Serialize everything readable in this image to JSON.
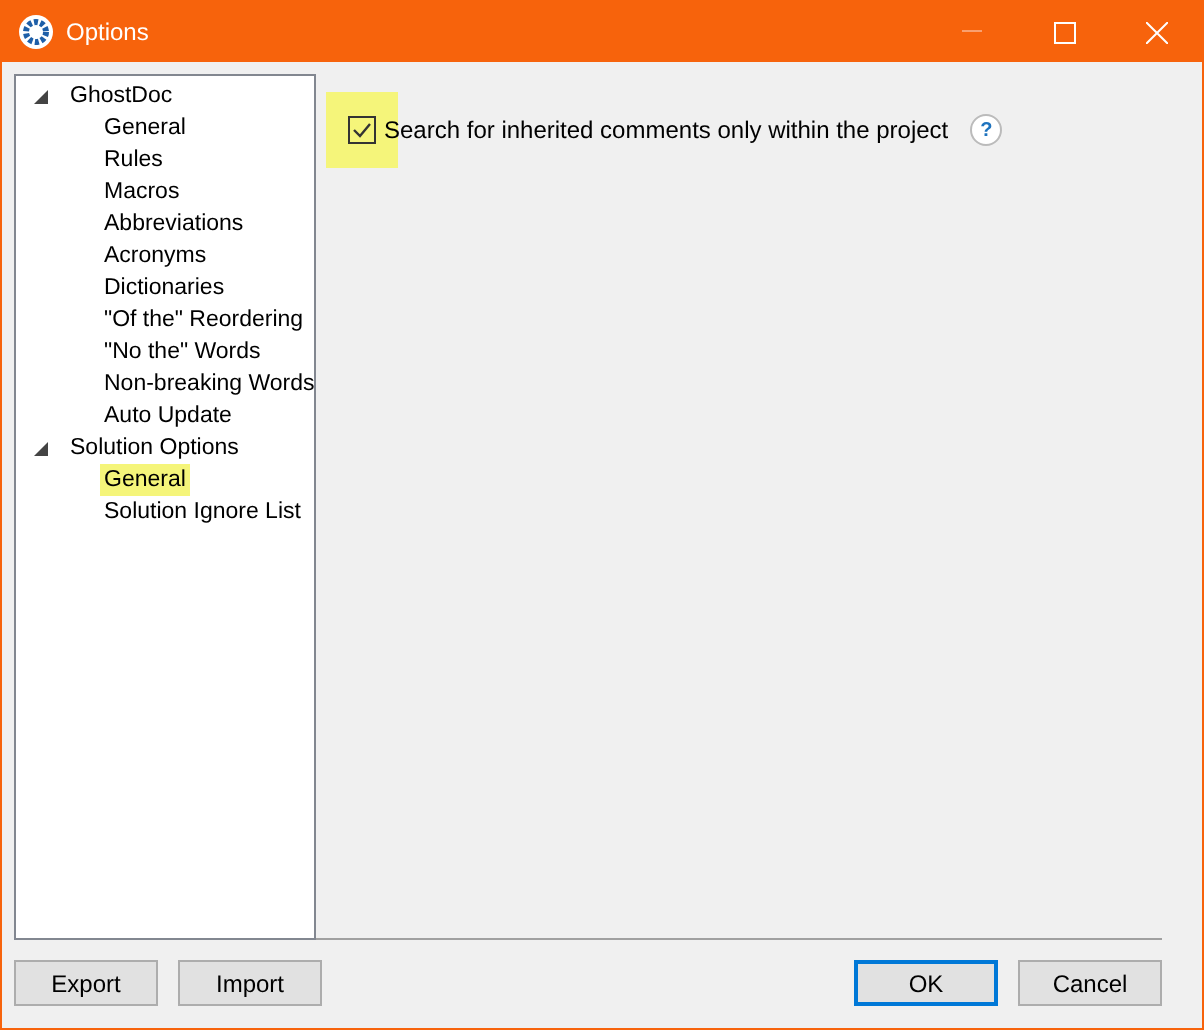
{
  "window": {
    "title": "Options",
    "minimize_disabled": true
  },
  "tree": [
    {
      "label": "GhostDoc",
      "expanded": true,
      "selected": false,
      "children": [
        {
          "label": "General",
          "selected": false
        },
        {
          "label": "Rules",
          "selected": false
        },
        {
          "label": "Macros",
          "selected": false
        },
        {
          "label": "Abbreviations",
          "selected": false
        },
        {
          "label": "Acronyms",
          "selected": false
        },
        {
          "label": "Dictionaries",
          "selected": false
        },
        {
          "label": "\"Of the\" Reordering",
          "selected": false
        },
        {
          "label": "\"No the\" Words",
          "selected": false
        },
        {
          "label": "Non-breaking Words",
          "selected": false
        },
        {
          "label": "Auto Update",
          "selected": false
        }
      ]
    },
    {
      "label": "Solution Options",
      "expanded": true,
      "selected": false,
      "children": [
        {
          "label": "General",
          "selected": true
        },
        {
          "label": "Solution Ignore List",
          "selected": false
        }
      ]
    }
  ],
  "option": {
    "label": "Search for inherited comments only within the project",
    "checked": true,
    "highlighted": true,
    "help": "?"
  },
  "left_buttons": [
    {
      "label": "Export",
      "default": false
    },
    {
      "label": "Import",
      "default": false
    }
  ],
  "right_buttons": [
    {
      "label": "OK",
      "default": true
    },
    {
      "label": "Cancel",
      "default": false
    }
  ]
}
